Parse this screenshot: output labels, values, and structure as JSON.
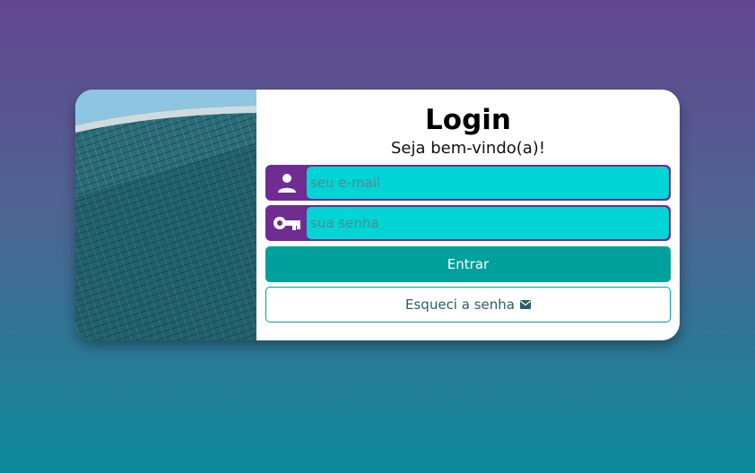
{
  "login": {
    "title": "Login",
    "subtitle": "Seja bem-vindo(a)!",
    "email_placeholder": "seu e-mail",
    "password_placeholder": "sua senha",
    "submit_label": "Entrar",
    "forgot_label": "Esqueci a senha"
  },
  "icons": {
    "email_field": "user-icon",
    "password_field": "key-icon",
    "forgot": "envelope-icon"
  },
  "colors": {
    "accent_purple": "#6f2c91",
    "input_fill": "#00d4d4",
    "primary_button": "#00a09d"
  }
}
